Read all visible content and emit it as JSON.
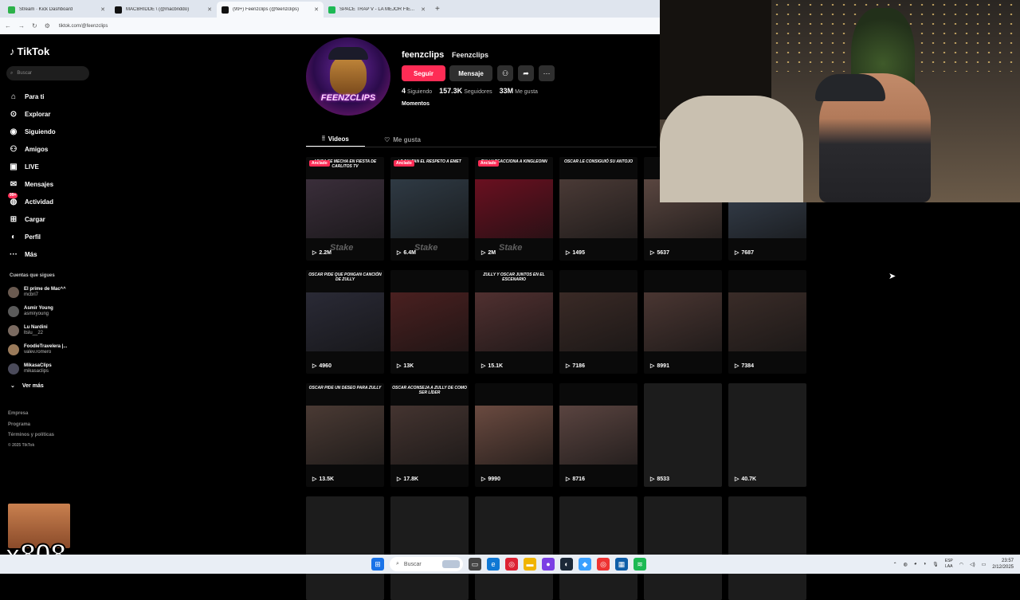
{
  "browser": {
    "tabs": [
      {
        "title": "Stream · Kick Dashboard",
        "color": "#2db24a",
        "active": false
      },
      {
        "title": "MACBRIDDE \\ (@macbriddo)",
        "color": "#111111",
        "active": false
      },
      {
        "title": "(99+) Feenzclips (@feenzclips)",
        "color": "#111111",
        "active": true
      },
      {
        "title": "SPACE TRAP V - LA MEJOR FIE...",
        "color": "#1db954",
        "active": false
      }
    ],
    "new_tab": "+",
    "url": "tiktok.com/@feenzclips"
  },
  "sidebar": {
    "logo": "TikTok",
    "search_placeholder": "Buscar",
    "nav": [
      {
        "label": "Para ti",
        "icon": "home-icon",
        "glyph": "⌂"
      },
      {
        "label": "Explorar",
        "icon": "compass-icon",
        "glyph": "⊙"
      },
      {
        "label": "Siguiendo",
        "icon": "following-avatar-icon",
        "glyph": "◉"
      },
      {
        "label": "Amigos",
        "icon": "friends-icon",
        "glyph": "⚇"
      },
      {
        "label": "LIVE",
        "icon": "live-icon",
        "glyph": "▣"
      },
      {
        "label": "Mensajes",
        "icon": "messages-icon",
        "glyph": "✉"
      },
      {
        "label": "Actividad",
        "icon": "activity-icon",
        "glyph": "◍",
        "badge": "99+"
      },
      {
        "label": "Cargar",
        "icon": "upload-icon",
        "glyph": "⊞"
      },
      {
        "label": "Perfil",
        "icon": "profile-icon",
        "glyph": "◐"
      },
      {
        "label": "Más",
        "icon": "more-icon",
        "glyph": "···"
      }
    ],
    "following_heading": "Cuentas que sigues",
    "accounts": [
      {
        "name": "El prime de Mac^^",
        "handle": "mcbri7"
      },
      {
        "name": "Asmir Young",
        "handle": "asmiryoung"
      },
      {
        "name": "Lu Nardini",
        "handle": "ltslu__22"
      },
      {
        "name": "FoodieTravelera |...",
        "handle": "valev.romero"
      },
      {
        "name": "MikasaClips",
        "handle": "mikasaclips"
      }
    ],
    "see_more": "Ver más",
    "footer": [
      "Empresa",
      "Programa",
      "Términos y políticas"
    ],
    "copyright": "© 2025 TikTok"
  },
  "profile": {
    "avatar_text": "FEENZCLIPS",
    "username": "feenzclips",
    "display_name": "Feenzclips",
    "follow_label": "Seguir",
    "message_label": "Mensaje",
    "stats": [
      {
        "value": "4",
        "label": "Siguiendo"
      },
      {
        "value": "157.3K",
        "label": "Seguidores"
      },
      {
        "value": "33M",
        "label": "Me gusta"
      }
    ],
    "moments": "Momentos",
    "tabs": [
      "Videos",
      "Me gusta"
    ]
  },
  "videos": [
    {
      "views": "2.2M",
      "pinned": "Anclado",
      "caption": "Adica se mecha en fiesta de Carlitos TV",
      "thumb": "#3a2e3a",
      "stake": "Stake"
    },
    {
      "views": "6.4M",
      "pinned": "Anclado",
      "caption": "Le faltan el respeto a Emet",
      "thumb": "#2f3a44",
      "stake": "Stake"
    },
    {
      "views": "2M",
      "pinned": "Anclado",
      "caption": "Zully reacciona a Kingleonn",
      "thumb": "#6a1020",
      "stake": "Stake"
    },
    {
      "views": "1495",
      "pinned": "",
      "caption": "Oscar le consiguió su antojo",
      "thumb": "#4a3a36",
      "stake": ""
    },
    {
      "views": "5637",
      "pinned": "",
      "caption": "",
      "thumb": "#5a4640",
      "stake": ""
    },
    {
      "views": "7687",
      "pinned": "",
      "caption": "",
      "thumb": "#384250",
      "stake": ""
    },
    {
      "views": "4960",
      "pinned": "",
      "caption": "Oscar pide que pongan canción de Zully",
      "thumb": "#2a2a36",
      "stake": ""
    },
    {
      "views": "13K",
      "pinned": "",
      "caption": "",
      "thumb": "#4a2020",
      "stake": ""
    },
    {
      "views": "15.1K",
      "pinned": "",
      "caption": "Zully y Oscar juntos en el escenario",
      "thumb": "#503030",
      "stake": ""
    },
    {
      "views": "7186",
      "pinned": "",
      "caption": "",
      "thumb": "#3a2a26",
      "stake": ""
    },
    {
      "views": "8991",
      "pinned": "",
      "caption": "",
      "thumb": "#4a3632",
      "stake": ""
    },
    {
      "views": "7384",
      "pinned": "",
      "caption": "",
      "thumb": "#3a2c28",
      "stake": ""
    },
    {
      "views": "13.5K",
      "pinned": "",
      "caption": "Oscar pide un deseo para Zully",
      "thumb": "#4a3a34",
      "stake": ""
    },
    {
      "views": "17.8K",
      "pinned": "",
      "caption": "Oscar aconseja a Zully de como ser líder",
      "thumb": "#443430",
      "stake": ""
    },
    {
      "views": "9990",
      "pinned": "",
      "caption": "",
      "thumb": "#6a4a40",
      "stake": ""
    },
    {
      "views": "8716",
      "pinned": "",
      "caption": "",
      "thumb": "#5a4440",
      "stake": ""
    },
    {
      "views": "8533",
      "pinned": "",
      "caption": "",
      "thumb": "",
      "stake": ""
    },
    {
      "views": "40.7K",
      "pinned": "",
      "caption": "",
      "thumb": "",
      "stake": ""
    },
    {
      "views": "",
      "pinned": "",
      "caption": "",
      "thumb": "",
      "stake": ""
    },
    {
      "views": "",
      "pinned": "",
      "caption": "",
      "thumb": "",
      "stake": ""
    },
    {
      "views": "",
      "pinned": "",
      "caption": "",
      "thumb": "",
      "stake": ""
    },
    {
      "views": "",
      "pinned": "",
      "caption": "",
      "thumb": "",
      "stake": ""
    },
    {
      "views": "",
      "pinned": "",
      "caption": "",
      "thumb": "",
      "stake": ""
    },
    {
      "views": "",
      "pinned": "",
      "caption": "",
      "thumb": "",
      "stake": ""
    }
  ],
  "overlay": {
    "reaction_text": "x808"
  },
  "taskbar": {
    "search_placeholder": "Buscar",
    "lang_top": "ESP",
    "lang_bottom": "LAA",
    "time": "23:57",
    "date": "2/12/2025"
  },
  "colors": {
    "accent": "#fe2c55",
    "background": "#000000"
  }
}
